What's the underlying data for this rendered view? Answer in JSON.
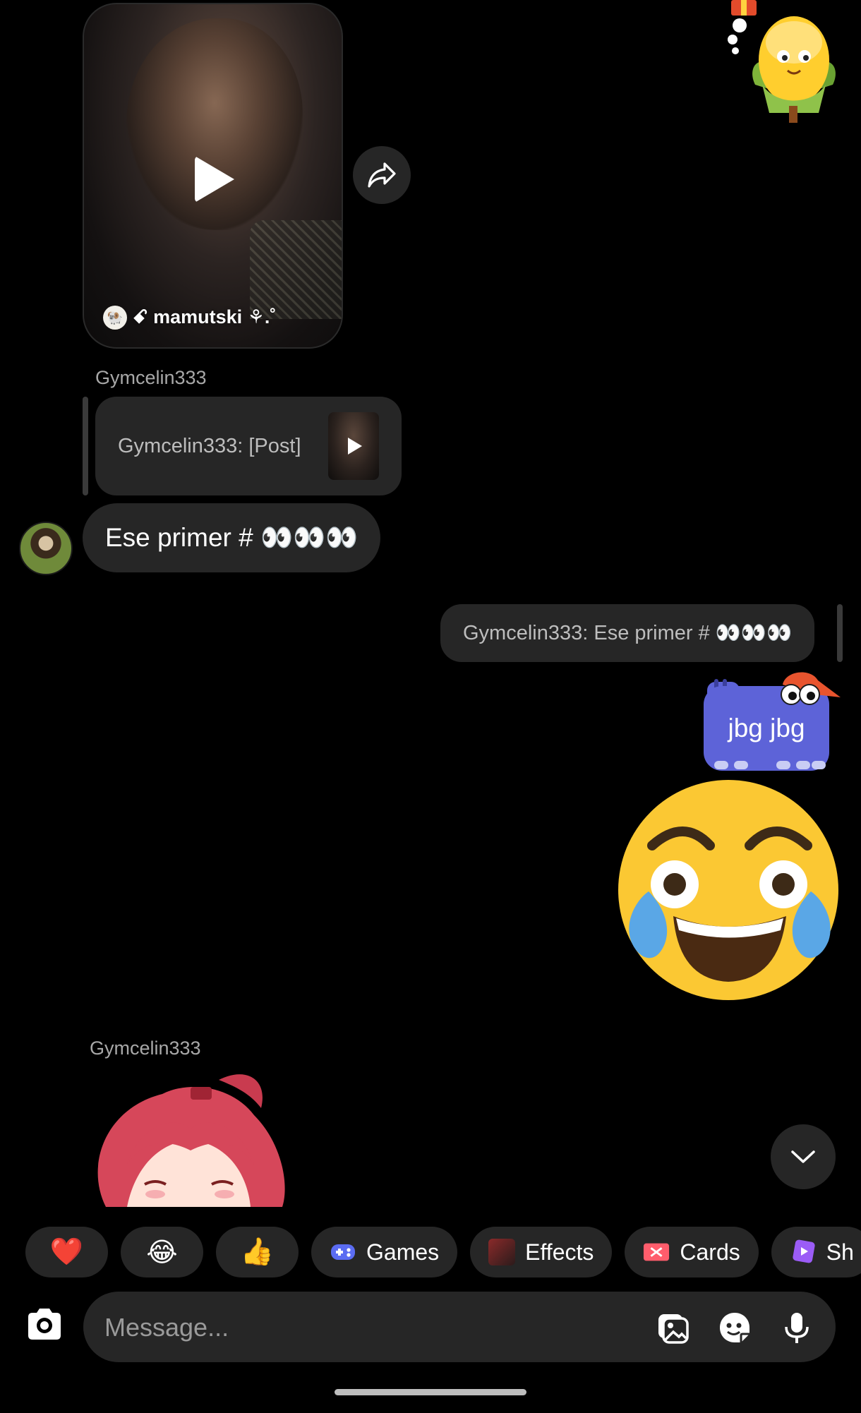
{
  "thread": {
    "video_post": {
      "author": "ꗃ mamutski ⚘.˚",
      "author_avatar": "profile-avatar",
      "play_icon": "play-icon"
    },
    "share_icon": "share-icon",
    "corn_sticker": "corn-sticker",
    "messages": {
      "reply_sender": "Gymcelin333",
      "reply_quote": "Gymcelin333: [Post]",
      "incoming_text": "Ese primer # 👀👀👀",
      "outgoing_quote": "Gymcelin333: Ese primer # 👀👀👀",
      "outgoing_text": "jbg jbg",
      "outgoing_sticker": "laughing-tears-emoji",
      "sender_2": "Gymcelin333",
      "anime_sticker": "anime-girl-sticker"
    }
  },
  "quick_bar": {
    "emoji_1": "❤️",
    "emoji_2": "😂",
    "emoji_3": "👍",
    "games": "Games",
    "effects": "Effects",
    "cards": "Cards",
    "shop": "Sh"
  },
  "composer": {
    "placeholder": "Message..."
  },
  "colors": {
    "background": "#000000",
    "bubble": "#262626",
    "accent_bubble": "#5d63d8",
    "meta_text": "#a8a8a8"
  }
}
